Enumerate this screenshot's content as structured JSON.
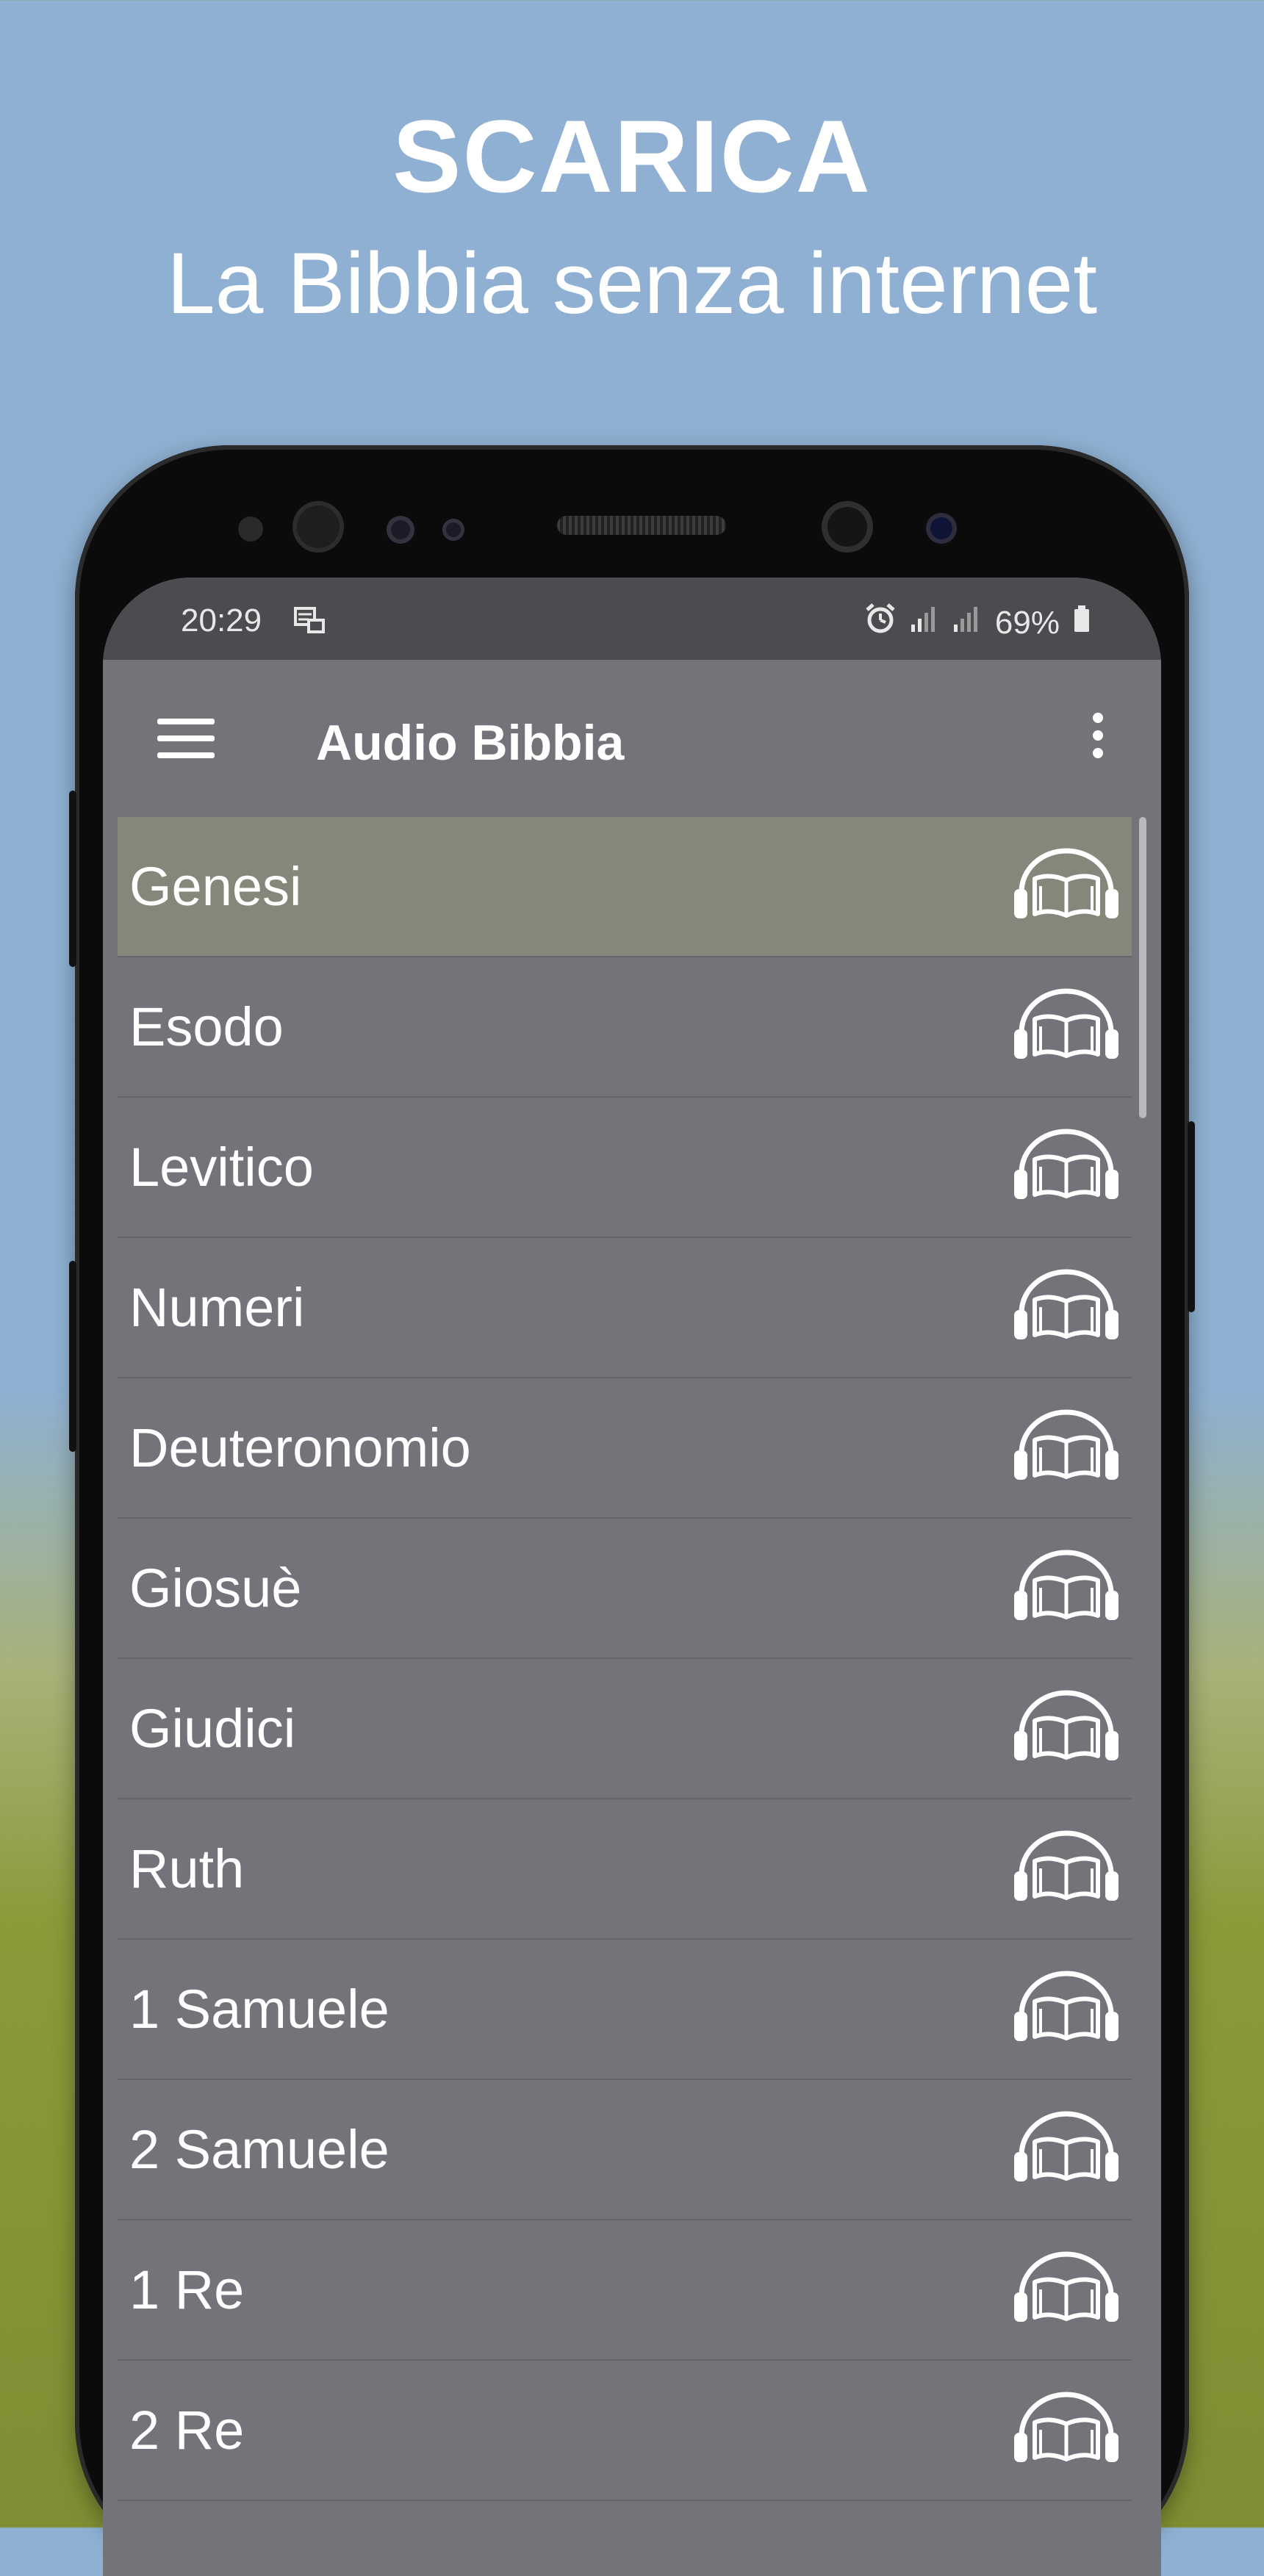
{
  "promo": {
    "title": "SCARICA",
    "subtitle": "La Bibbia senza internet"
  },
  "status_bar": {
    "time": "20:29",
    "battery": "69%",
    "icons": [
      "storage-sync-icon",
      "alarm-icon",
      "signal-icon",
      "signal-icon",
      "battery-icon"
    ]
  },
  "app_bar": {
    "title": "Audio Bibbia",
    "left_icon": "menu-icon",
    "right_icon": "more-vert-icon"
  },
  "book_list": {
    "items": [
      {
        "label": "Genesi",
        "selected": true
      },
      {
        "label": "Esodo"
      },
      {
        "label": "Levitico"
      },
      {
        "label": "Numeri"
      },
      {
        "label": "Deuteronomio"
      },
      {
        "label": "Giosuè"
      },
      {
        "label": "Giudici"
      },
      {
        "label": "Ruth"
      },
      {
        "label": "1 Samuele"
      },
      {
        "label": "2 Samuele"
      },
      {
        "label": "1 Re"
      },
      {
        "label": "2 Re"
      }
    ],
    "item_icon": "headphones-book-icon"
  },
  "colors": {
    "screen_bg": "#737479",
    "status_bg": "#4a4c50",
    "selected_bg": "#85877a",
    "text": "#ffffff"
  }
}
